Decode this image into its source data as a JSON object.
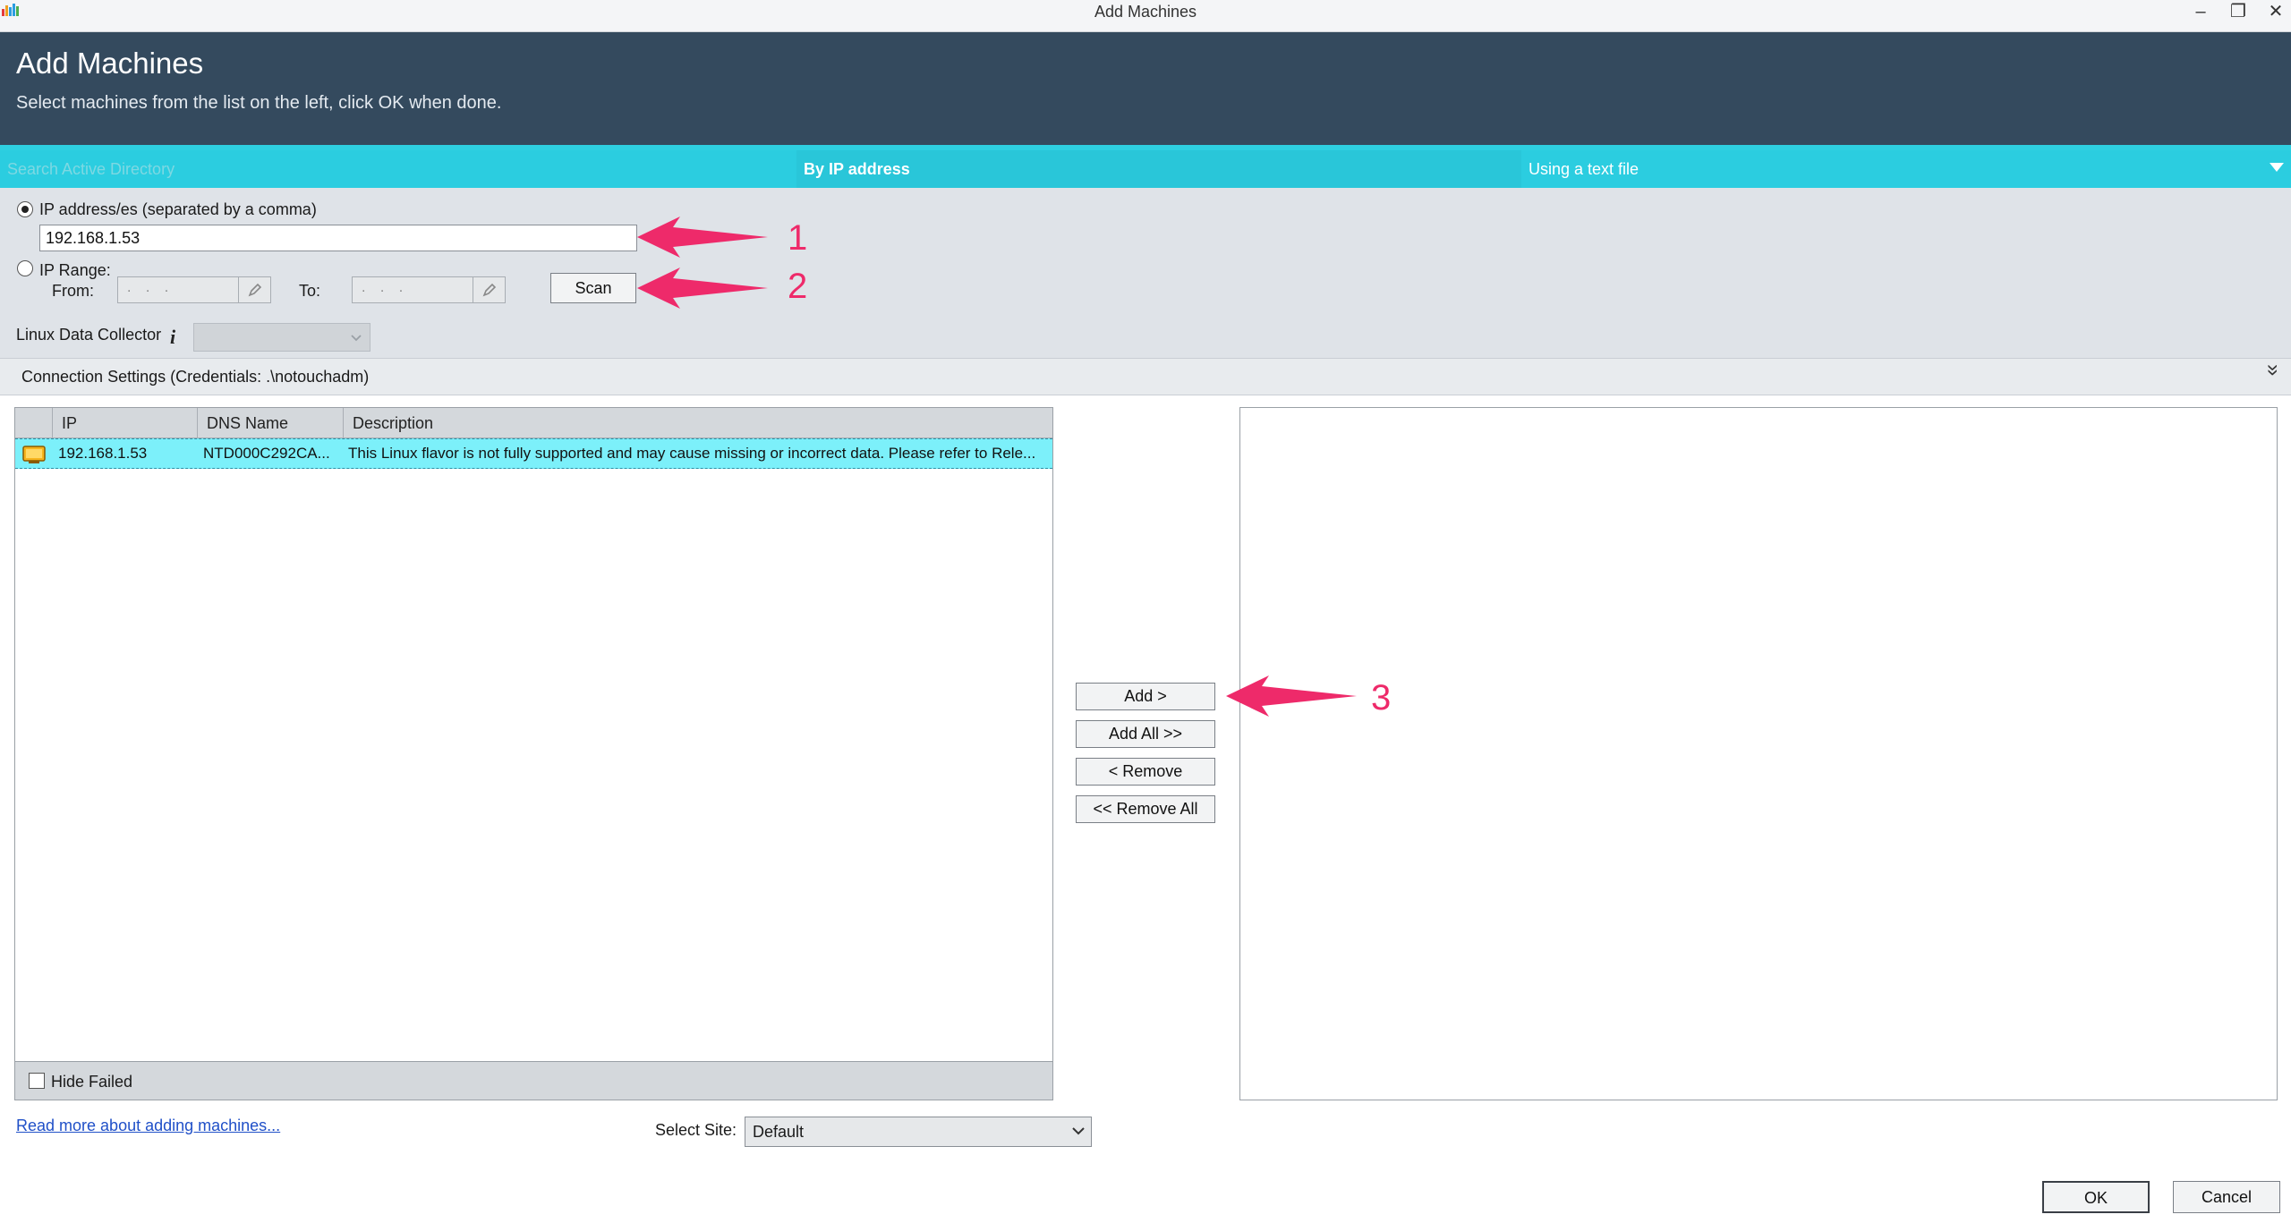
{
  "window": {
    "title": "Add Machines",
    "controls": {
      "minimize": "–",
      "restore": "❐",
      "close": "✕"
    }
  },
  "header": {
    "title": "Add Machines",
    "subtitle": "Select machines from the list on the left, click OK when done."
  },
  "tabs": [
    {
      "label": "Search Active Directory",
      "active": false
    },
    {
      "label": "By IP address",
      "active": true
    },
    {
      "label": "Using a text file",
      "active": false
    }
  ],
  "ip_section": {
    "addresses_label": "IP address/es (separated by a comma)",
    "addresses_value": "192.168.1.53",
    "range_label": "IP Range:",
    "from_label": "From:",
    "to_label": "To:",
    "ip_placeholder": ".  .  .",
    "scan_label": "Scan",
    "selected_mode": "addresses"
  },
  "linux_collector": {
    "label": "Linux Data Collector",
    "info_icon_text": "i",
    "value": ""
  },
  "connection_settings": {
    "label": "Connection Settings (Credentials: .\\notouchadm)",
    "expand_glyph": "»"
  },
  "machine_list": {
    "columns": [
      "IP",
      "DNS Name",
      "Description"
    ],
    "rows": [
      {
        "ip": "192.168.1.53",
        "dns": "NTD000C292CA...",
        "description": "This Linux flavor is not fully supported and may cause missing or incorrect data. Please refer to Rele..."
      }
    ],
    "hide_failed_label": "Hide Failed",
    "hide_failed_checked": false
  },
  "transfer_buttons": {
    "add": "Add >",
    "add_all": "Add All >>",
    "remove": "< Remove",
    "remove_all": "<< Remove All"
  },
  "footer": {
    "read_more": "Read more about adding machines...",
    "select_site_label": "Select Site:",
    "select_site_value": "Default",
    "ok": "OK",
    "cancel": "Cancel"
  },
  "annotations": [
    {
      "number": "1",
      "color": "#ee2a6a"
    },
    {
      "number": "2",
      "color": "#ee2a6a"
    },
    {
      "number": "3",
      "color": "#ee2a6a"
    }
  ]
}
